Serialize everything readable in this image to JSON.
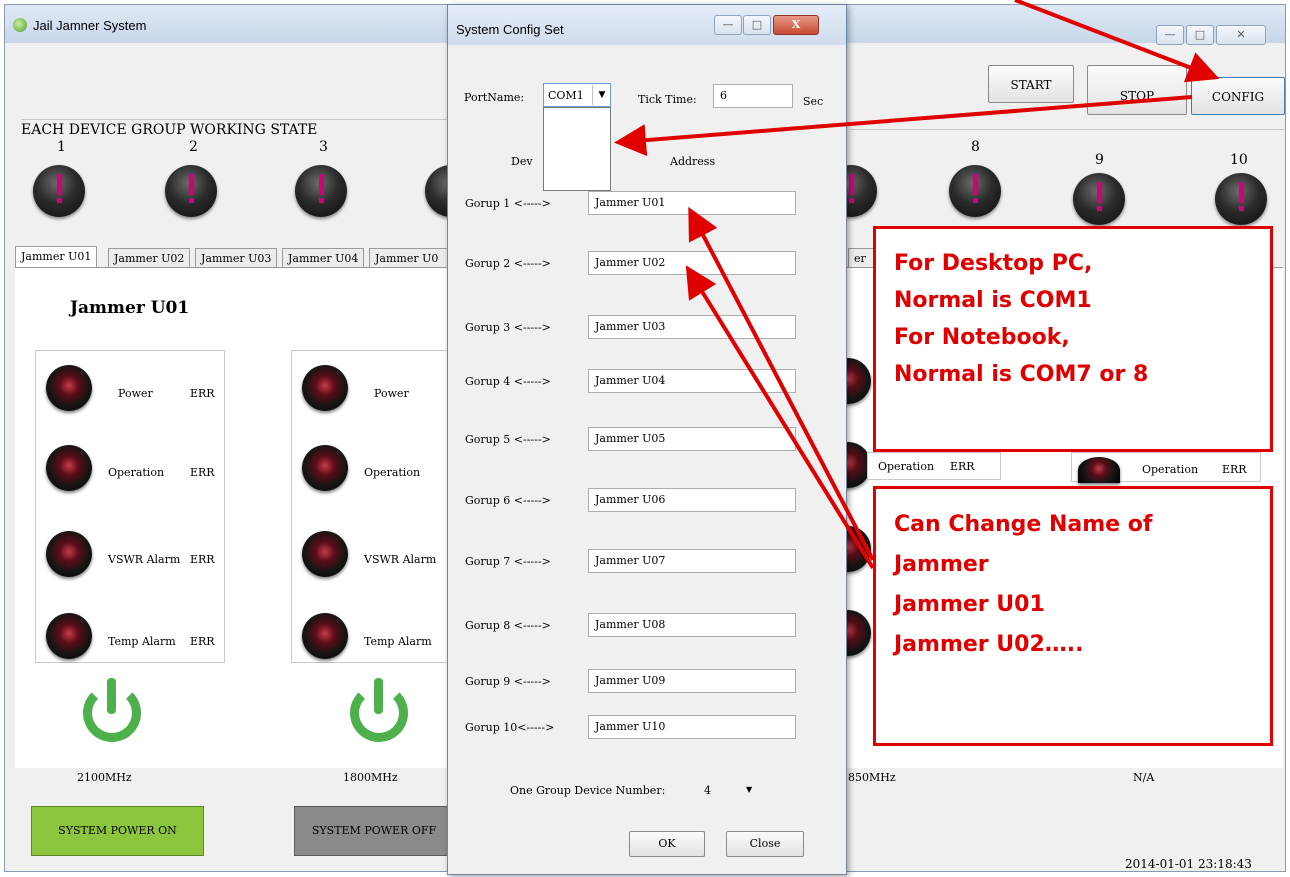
{
  "main_window": {
    "title": "Jail Jamner System",
    "buttons": {
      "start": "START",
      "stop": "STOP",
      "config": "CONFIG"
    },
    "group_section_title": "EACH DEVICE GROUP WORKING STATE",
    "group_numbers": [
      "1",
      "2",
      "3",
      "8",
      "9",
      "10"
    ],
    "tabs": [
      "Jammer U01",
      "Jammer U02",
      "Jammer U03",
      "Jammer U04",
      "Jammer U0"
    ],
    "tab_fragment_right": "er",
    "current_jammer": "Jammer U01",
    "status_rows": [
      {
        "label": "Power",
        "status": "ERR"
      },
      {
        "label": "Operation",
        "status": "ERR"
      },
      {
        "label": "VSWR Alarm",
        "status": "ERR"
      },
      {
        "label": "Temp Alarm",
        "status": "ERR"
      }
    ],
    "panel2_rows": [
      "Power",
      "Operation",
      "VSWR Alarm",
      "Temp Alarm"
    ],
    "right_operation_label": "Operation",
    "right_operation_status": "ERR",
    "right2_operation_label": "Operation",
    "right2_operation_status": "ERR",
    "freqs": [
      "2100MHz",
      "1800MHz",
      "850MHz",
      "N/A"
    ],
    "system_power_on": "SYSTEM POWER ON",
    "system_power_off": "SYSTEM POWER OFF",
    "datetime": "2014-01-01 23:18:43"
  },
  "dialog": {
    "title": "System Config Set",
    "port_label": "PortName:",
    "port_value": "COM1",
    "tick_label": "Tick Time:",
    "tick_value": "6",
    "tick_unit": "Sec",
    "dev_label": "Dev",
    "address_label": "Address",
    "groups": [
      {
        "label": "Gorup 1 <----->",
        "value": "Jammer U01"
      },
      {
        "label": "Gorup 2 <----->",
        "value": "Jammer U02"
      },
      {
        "label": "Gorup 3 <----->",
        "value": "Jammer U03"
      },
      {
        "label": "Gorup 4 <----->",
        "value": "Jammer U04"
      },
      {
        "label": "Gorup 5 <----->",
        "value": "Jammer U05"
      },
      {
        "label": "Gorup 6 <----->",
        "value": "Jammer U06"
      },
      {
        "label": "Gorup 7 <----->",
        "value": "Jammer U07"
      },
      {
        "label": "Gorup 8 <----->",
        "value": "Jammer U08"
      },
      {
        "label": "Gorup 9 <----->",
        "value": "Jammer U09"
      },
      {
        "label": "Gorup 10<----->",
        "value": "Jammer U10"
      }
    ],
    "device_number_label": "One Group Device Number:",
    "device_number_value": "4",
    "ok": "OK",
    "close": "Close"
  },
  "annotations": {
    "note1": [
      "For Desktop PC,",
      "Normal is COM1",
      "For Notebook,",
      "Normal is COM7 or 8"
    ],
    "note2": [
      "Can Change Name of",
      "Jammer",
      "Jammer U01",
      "Jammer U02….."
    ],
    "color": "#e00000"
  }
}
